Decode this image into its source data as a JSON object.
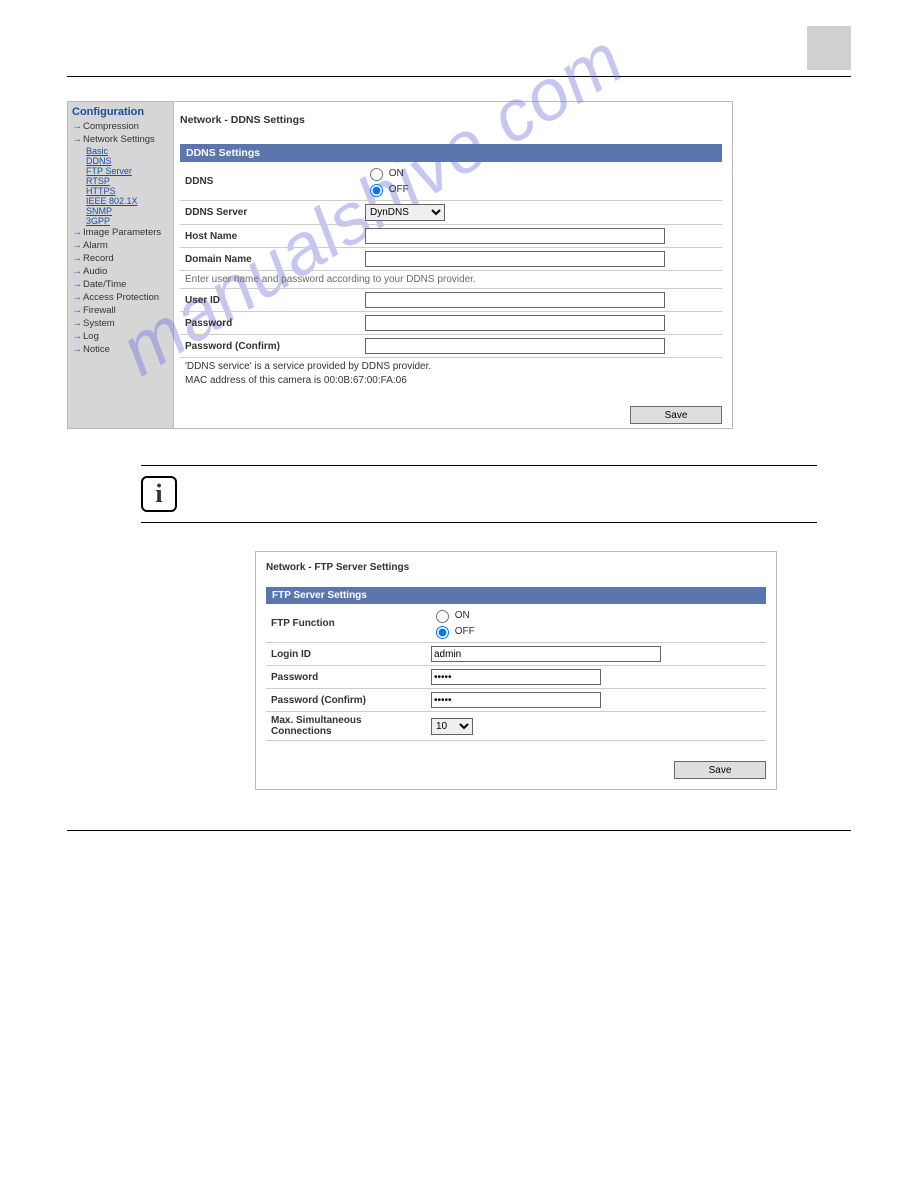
{
  "watermark": "manualshive.com",
  "sidebar": {
    "title": "Configuration",
    "items": [
      {
        "label": "Compression"
      },
      {
        "label": "Network Settings",
        "sub": [
          "Basic",
          "DDNS",
          "FTP Server",
          "RTSP",
          "HTTPS",
          "IEEE 802.1X",
          "SNMP",
          "3GPP"
        ]
      },
      {
        "label": "Image Parameters"
      },
      {
        "label": "Alarm"
      },
      {
        "label": "Record"
      },
      {
        "label": "Audio"
      },
      {
        "label": "Date/Time"
      },
      {
        "label": "Access Protection"
      },
      {
        "label": "Firewall"
      },
      {
        "label": "System"
      },
      {
        "label": "Log"
      },
      {
        "label": "Notice"
      }
    ]
  },
  "ddns": {
    "page_title": "Network - DDNS Settings",
    "panel_header": "DDNS Settings",
    "labels": {
      "ddns": "DDNS",
      "on": "ON",
      "off": "OFF",
      "server": "DDNS Server",
      "host": "Host Name",
      "domain": "Domain Name",
      "instruction": "Enter user name and password according to your DDNS provider.",
      "user": "User ID",
      "password": "Password",
      "password_confirm": "Password (Confirm)"
    },
    "server_value": "DynDNS",
    "help1": "'DDNS service' is a service provided by DDNS provider.",
    "help2": "MAC address of this camera is 00:0B:67:00:FA:06",
    "save": "Save"
  },
  "mid": {
    "heading": "",
    "para": "",
    "info_title": "",
    "info_text": ""
  },
  "ftp": {
    "page_title": "Network - FTP Server Settings",
    "panel_header": "FTP Server Settings",
    "labels": {
      "func": "FTP Function",
      "on": "ON",
      "off": "OFF",
      "login": "Login ID",
      "password": "Password",
      "password_confirm": "Password (Confirm)",
      "max": "Max. Simultaneous Connections"
    },
    "values": {
      "login": "admin",
      "password": "•••••",
      "password_confirm": "•••••",
      "max": "10"
    },
    "save": "Save"
  }
}
